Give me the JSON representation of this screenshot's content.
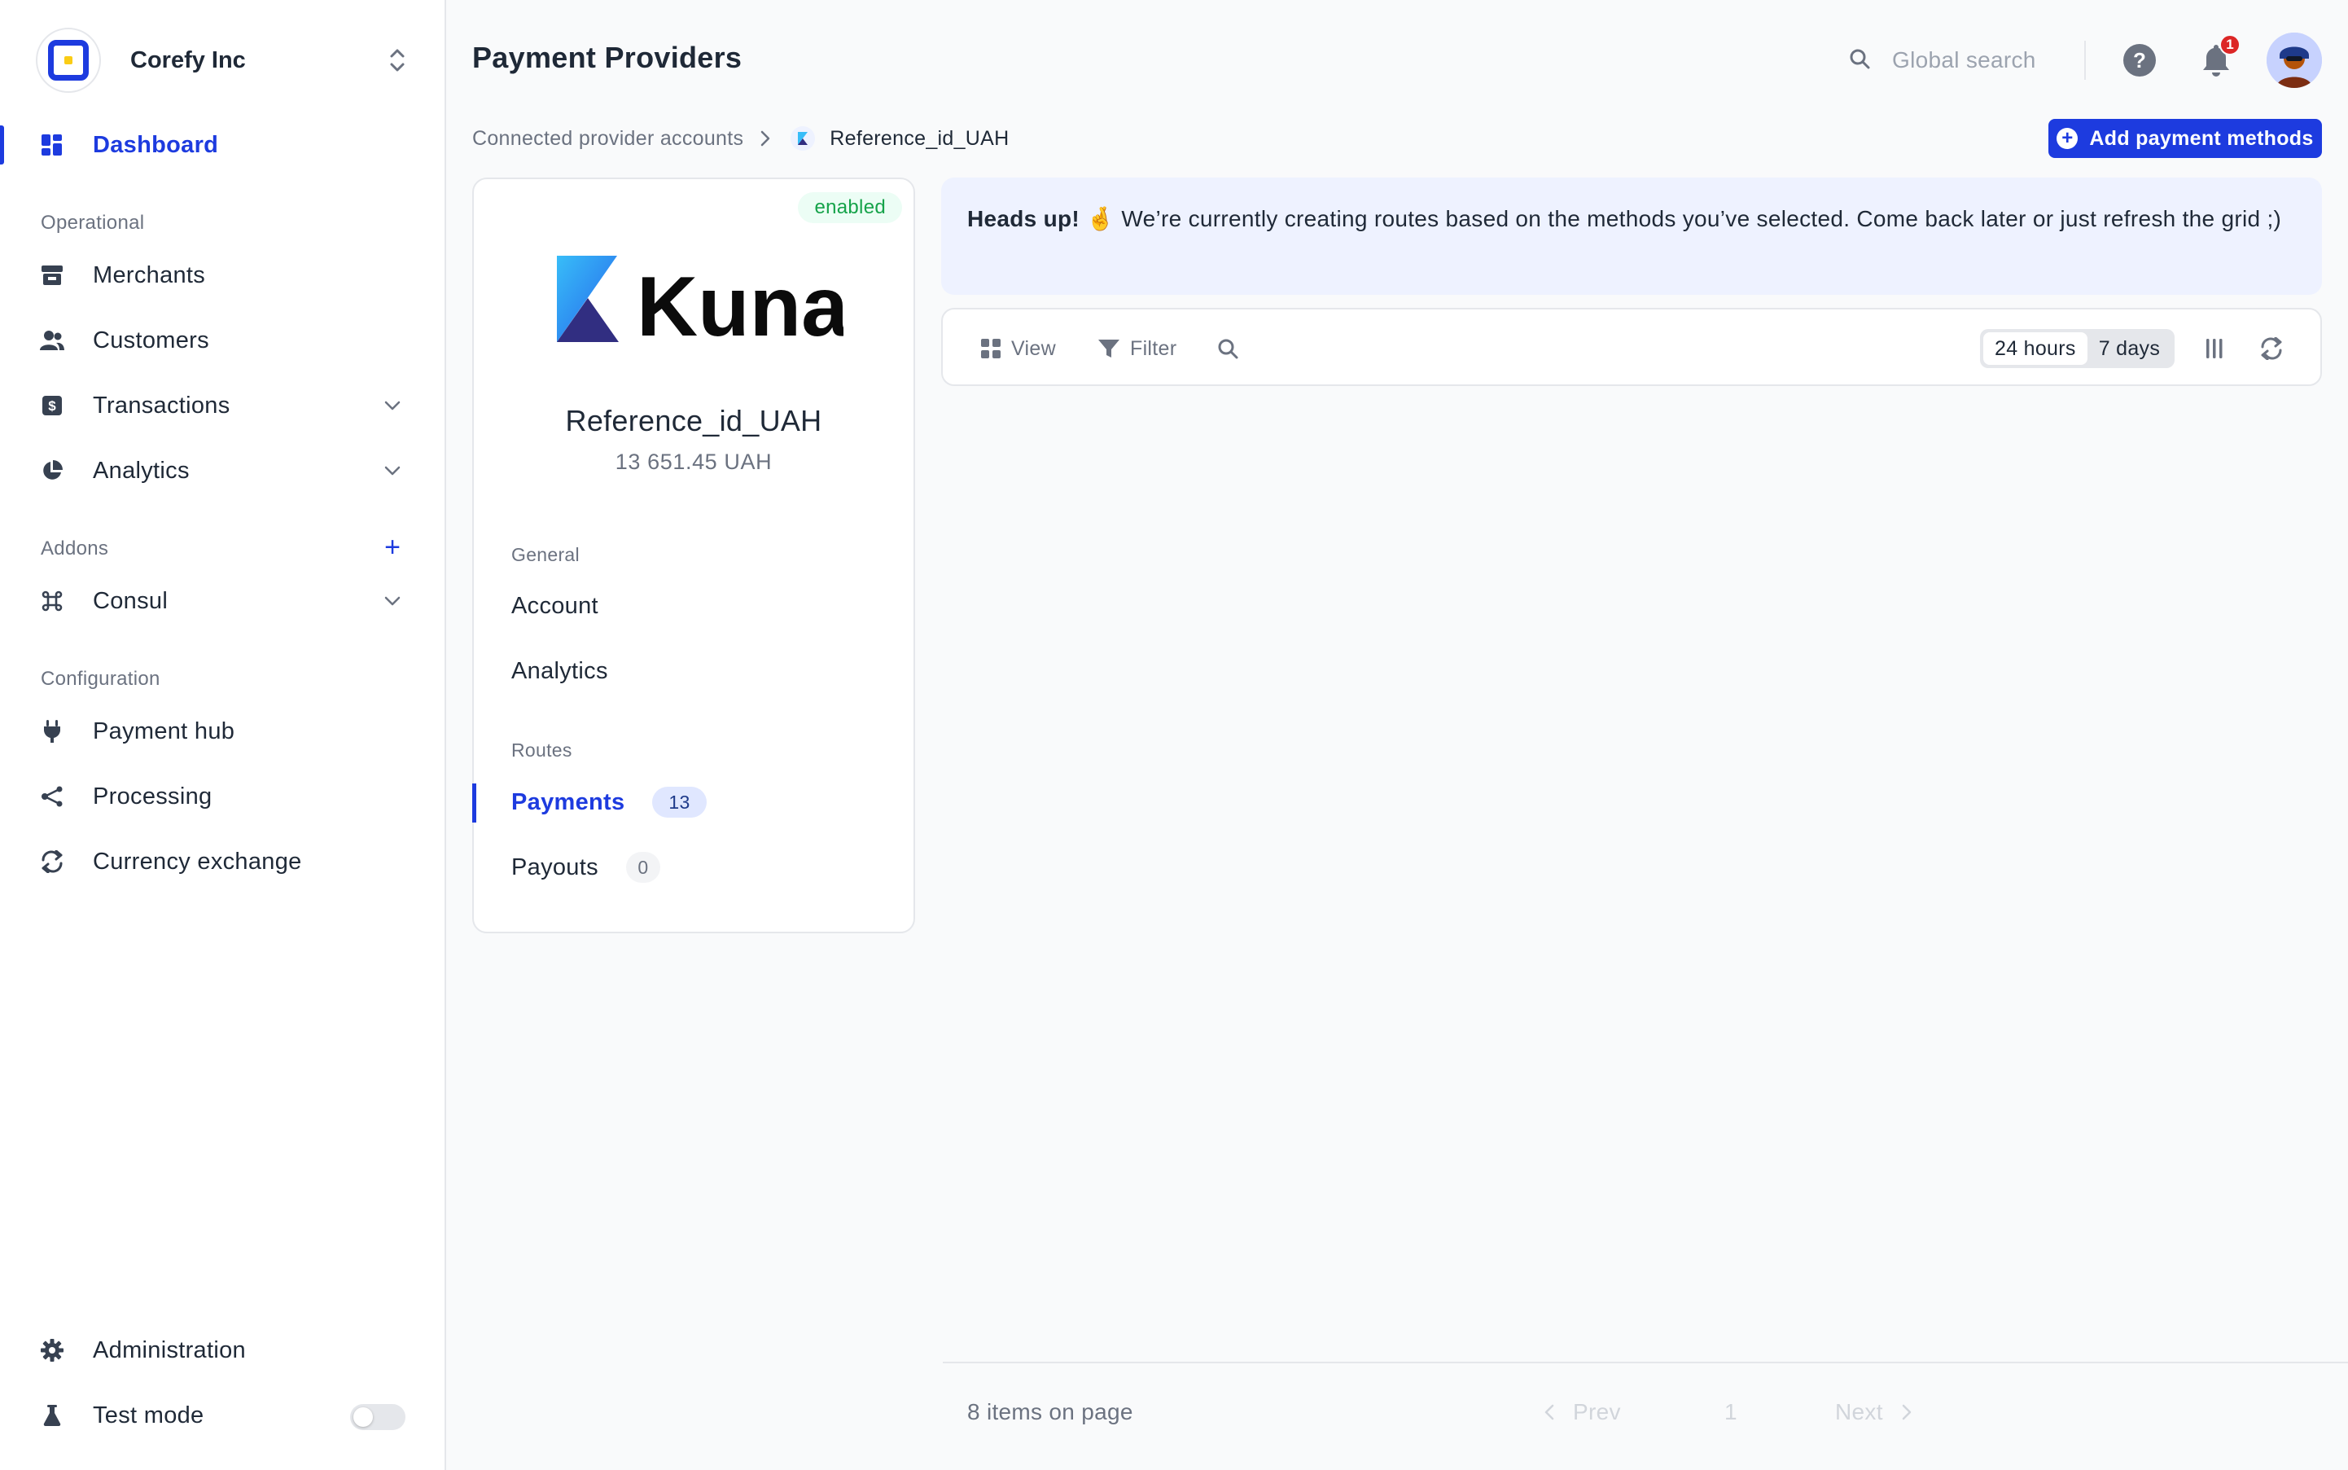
{
  "org": {
    "name": "Corefy Inc"
  },
  "sidebar": {
    "dashboard": "Dashboard",
    "sections": {
      "operational": "Operational",
      "addons": "Addons",
      "configuration": "Configuration"
    },
    "items": {
      "merchants": "Merchants",
      "customers": "Customers",
      "transactions": "Transactions",
      "analytics": "Analytics",
      "consul": "Consul",
      "payment_hub": "Payment hub",
      "processing": "Processing",
      "currency_exchange": "Currency exchange",
      "administration": "Administration",
      "test_mode": "Test mode"
    },
    "addons_plus": "+"
  },
  "header": {
    "title": "Payment Providers",
    "search_label": "Global search",
    "help": "?",
    "notifications_count": "1"
  },
  "breadcrumb": {
    "parent": "Connected provider accounts",
    "current": "Reference_id_UAH"
  },
  "actions": {
    "add_payment_methods": "Add payment methods"
  },
  "provider": {
    "status": "enabled",
    "logo_text": "Kuna",
    "name": "Reference_id_UAH",
    "balance": "13 651.45 UAH",
    "sections": {
      "general": "General",
      "routes": "Routes"
    },
    "items": {
      "account": "Account",
      "analytics": "Analytics",
      "payments": "Payments",
      "payouts": "Payouts"
    },
    "counts": {
      "payments": "13",
      "payouts": "0"
    }
  },
  "alert": {
    "title": "Heads up!",
    "emoji": "🤞",
    "message": "We’re currently creating routes based on the methods you’ve selected. Come back later or just refresh the grid ;)"
  },
  "toolbar": {
    "view": "View",
    "filter": "Filter",
    "period_24h": "24 hours",
    "period_7d": "7 days",
    "selected_period": "24 hours"
  },
  "pagination": {
    "items_on_page": "8 items on page",
    "prev": "Prev",
    "page": "1",
    "next": "Next"
  },
  "colors": {
    "accent": "#1d3bdf",
    "success": "#16a34a",
    "danger": "#dc2626",
    "alert_bg": "#eef2ff"
  },
  "icons": {
    "dashboard": "grid-icon",
    "merchants": "store-icon",
    "customers": "users-icon",
    "transactions": "dollar-icon",
    "analytics": "pie-chart-icon",
    "consul": "command-icon",
    "payment_hub": "plug-icon",
    "processing": "share-icon",
    "currency_exchange": "exchange-icon",
    "administration": "gear-icon",
    "test_mode": "flask-icon"
  }
}
